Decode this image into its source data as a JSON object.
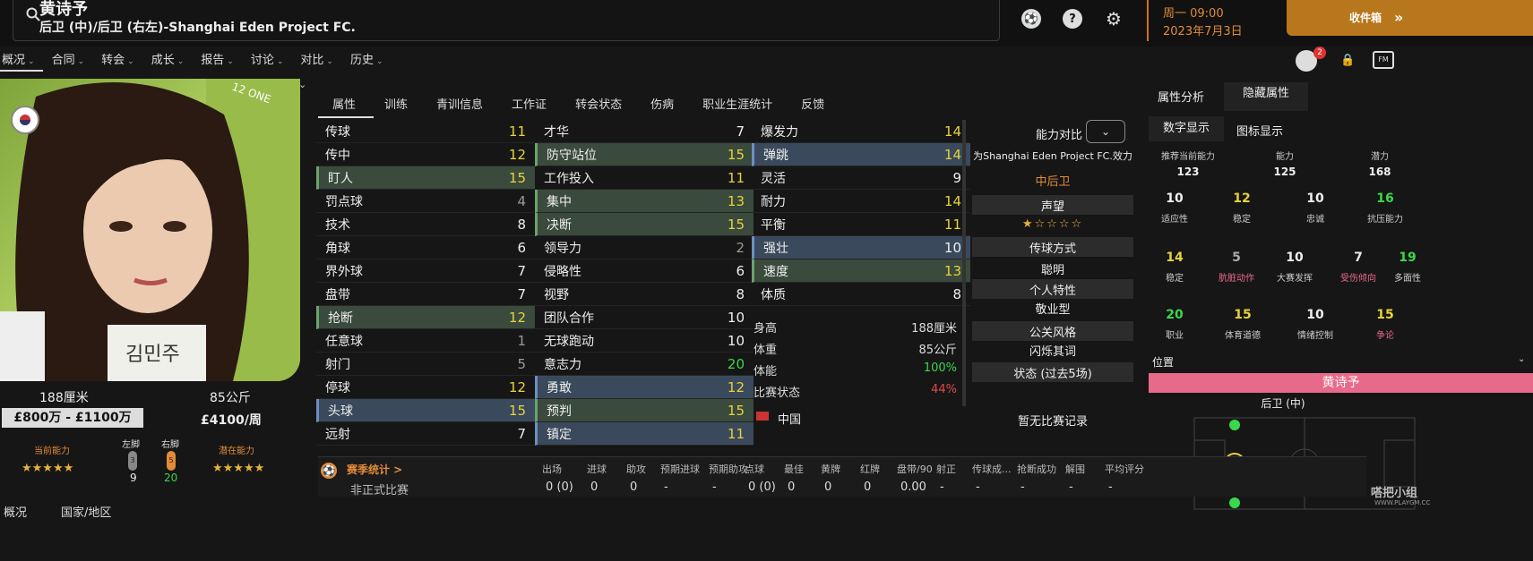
{
  "header": {
    "name": "黄诗予",
    "role": "后卫 (中)/后卫 (右左)-Shanghai Eden Project FC.",
    "date_line1": "周一 09:00",
    "date_line2": "2023年7月3日",
    "inbox": "收件箱",
    "inbox_arrow": "»",
    "badge_count": "2"
  },
  "nav": [
    "概况",
    "合同",
    "转会",
    "成长",
    "报告",
    "讨论",
    "对比",
    "历史"
  ],
  "player": {
    "height": "188厘米",
    "weight": "85公斤",
    "value": "£800万 - £1100万",
    "wage": "£4100/周",
    "ca_label": "当前能力",
    "pa_label": "潜在能力",
    "left_foot_label": "左脚",
    "right_foot_label": "右脚",
    "left_foot": "9",
    "right_foot": "20",
    "left_foot_badge": "3",
    "right_foot_badge": "5",
    "photo_text": "김민주"
  },
  "tabs": [
    "属性",
    "训练",
    "青训信息",
    "工作证",
    "转会状态",
    "伤病",
    "职业生涯统计",
    "反馈"
  ],
  "technical": [
    [
      "传球",
      "11"
    ],
    [
      "传中",
      "12"
    ],
    [
      "盯人",
      "15"
    ],
    [
      "罚点球",
      "4"
    ],
    [
      "技术",
      "8"
    ],
    [
      "角球",
      "6"
    ],
    [
      "界外球",
      "7"
    ],
    [
      "盘带",
      "7"
    ],
    [
      "抢断",
      "12"
    ],
    [
      "任意球",
      "1"
    ],
    [
      "射门",
      "5"
    ],
    [
      "停球",
      "12"
    ],
    [
      "头球",
      "15"
    ],
    [
      "远射",
      "7"
    ]
  ],
  "mental": [
    [
      "才华",
      "7"
    ],
    [
      "防守站位",
      "15"
    ],
    [
      "工作投入",
      "11"
    ],
    [
      "集中",
      "13"
    ],
    [
      "决断",
      "15"
    ],
    [
      "领导力",
      "2"
    ],
    [
      "侵略性",
      "6"
    ],
    [
      "视野",
      "8"
    ],
    [
      "团队合作",
      "10"
    ],
    [
      "无球跑动",
      "10"
    ],
    [
      "意志力",
      "20"
    ],
    [
      "勇敢",
      "12"
    ],
    [
      "预判",
      "15"
    ],
    [
      "镇定",
      "11"
    ]
  ],
  "physical": [
    [
      "爆发力",
      "14"
    ],
    [
      "弹跳",
      "14"
    ],
    [
      "灵活",
      "9"
    ],
    [
      "耐力",
      "14"
    ],
    [
      "平衡",
      "11"
    ],
    [
      "强壮",
      "10"
    ],
    [
      "速度",
      "13"
    ],
    [
      "体质",
      "8"
    ]
  ],
  "info": [
    [
      "身高",
      "188厘米"
    ],
    [
      "体重",
      "85公斤"
    ],
    [
      "体能",
      "100%"
    ],
    [
      "比赛状态",
      "44%"
    ]
  ],
  "nation": "中国",
  "mid": {
    "compare": "能力对比",
    "club_line": "为Shanghai Eden Project FC.效力",
    "position": "中后卫",
    "reputation": "声望",
    "pass_style": "传球方式",
    "pass_style_value": "聪明",
    "traits": "个人特性",
    "traits_value": "敬业型",
    "media": "公关风格",
    "media_value": "闪烁其词",
    "form": "状态 (过去5场)",
    "form_value": "暂无比赛记录"
  },
  "right": {
    "tab1": "属性分析",
    "tab2": "隐藏属性",
    "sub1": "数字显示",
    "sub2": "图标显示",
    "top": [
      [
        "推荐当前能力",
        "123"
      ],
      [
        "能力",
        "125"
      ],
      [
        "潜力",
        "168"
      ]
    ],
    "hidden": [
      [
        "10",
        "适应性"
      ],
      [
        "12",
        "稳定"
      ],
      [
        "10",
        "忠诚"
      ],
      [
        "16",
        "抗压能力"
      ],
      [
        "14",
        "稳定"
      ],
      [
        "5",
        "肮脏动作"
      ],
      [
        "10",
        "大赛发挥"
      ],
      [
        "7",
        "受伤倾向"
      ],
      [
        "19",
        "多面性"
      ],
      [
        "20",
        "职业"
      ],
      [
        "15",
        "体育道德"
      ],
      [
        "10",
        "情绪控制"
      ],
      [
        "15",
        "争论"
      ]
    ],
    "position_title": "位置",
    "position_name": "黄诗予",
    "position_sub": "后卫 (中)"
  },
  "season": {
    "title": "赛季统计 >",
    "row_label": "非正式比赛",
    "headers": [
      "出场",
      "进球",
      "助攻",
      "预期进球",
      "预期助攻",
      "点球",
      "最佳",
      "黄牌",
      "红牌",
      "盘带/90",
      "射正",
      "传球成...",
      "抢断成功",
      "解围",
      "平均评分"
    ],
    "values": [
      "0 (0)",
      "0",
      "0",
      "-",
      "-",
      "0 (0)",
      "0",
      "0",
      "0",
      "0.00",
      "-",
      "-",
      "-",
      "-",
      "-"
    ]
  },
  "footer": {
    "left1": "概况",
    "left2": "国家/地区",
    "watermark": "嗒把小组",
    "watermark_url": "WWW.PLAYGM.CC"
  },
  "colors": {
    "accent": "#e28b3a",
    "yellow": "#e8d23a",
    "green": "#3ad84a",
    "red": "#e04a4a",
    "pink": "#e86a8a"
  }
}
